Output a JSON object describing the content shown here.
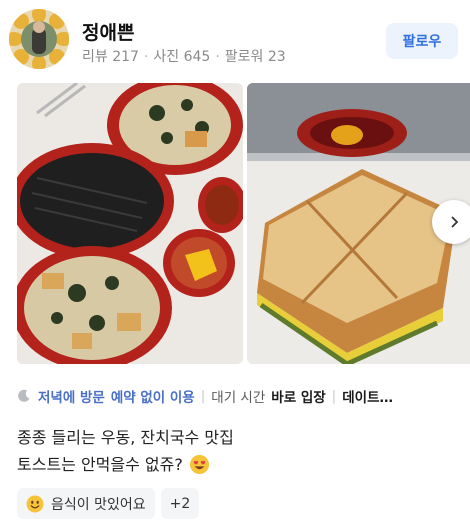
{
  "user": {
    "name": "정애쁜",
    "reviews": "리뷰 217",
    "photos": "사진 645",
    "followers": "팔로워 23",
    "separator": "·",
    "follow_label": "팔로우"
  },
  "photos": [
    {
      "icon": "udon-kimbap-photo"
    },
    {
      "icon": "toast-photo"
    }
  ],
  "visit_tags": {
    "icon": "moon-icon",
    "time": "저녁에 방문",
    "reservation": "예약 없이 이용",
    "wait_label": "대기 시간",
    "wait_value": "바로 입장",
    "extra": "데이트…"
  },
  "review": {
    "line1": "종종 들리는 우동, 잔치국수 맛집",
    "line2": "토스트는 안먹을수 없쥬?",
    "emoji": "heart-eyes-emoji"
  },
  "keywords": {
    "first": "음식이 맛있어요",
    "more": "+2"
  },
  "colors": {
    "accent": "#4a6fc9",
    "follow_bg": "#edf3fd",
    "follow_text": "#2f6fe0"
  }
}
